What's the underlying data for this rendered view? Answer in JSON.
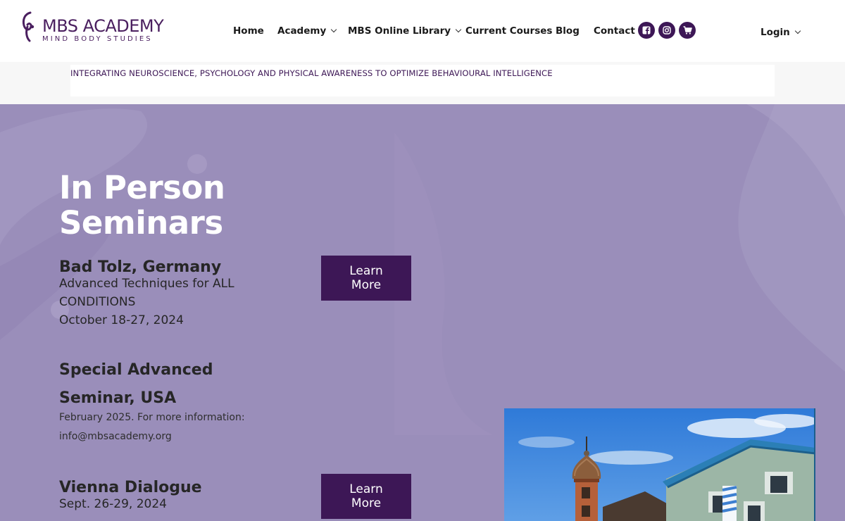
{
  "brand": {
    "title": "MBS ACADEMY",
    "subtitle": "MIND BODY STUDIES",
    "color": "#4a1f5f"
  },
  "nav": {
    "items": [
      {
        "label": "Home",
        "dropdown": false
      },
      {
        "label": "Academy",
        "dropdown": true
      },
      {
        "label": "MBS Online Library",
        "dropdown": true
      },
      {
        "label": "Current Courses",
        "dropdown": false
      },
      {
        "label": "Blog",
        "dropdown": false
      },
      {
        "label": "Contact",
        "dropdown": false
      }
    ],
    "social": [
      "facebook-icon",
      "instagram-icon",
      "cart-icon"
    ],
    "login": "Login"
  },
  "tagline": "INTEGRATING NEUROSCIENCE, PSYCHOLOGY AND PHYSICAL AWARENESS TO OPTIMIZE BEHAVIOURAL INTELLIGENCE",
  "hero": {
    "title_line1": "In Person",
    "title_line2": "Seminars",
    "background": "#9a8eba",
    "accent": "#3d1756"
  },
  "seminars": [
    {
      "title": "Bad Tolz, Germany",
      "line1": "Advanced Techniques for ALL",
      "line2": "CONDITIONS",
      "line3": "October 18-27, 2024",
      "button": "Learn More"
    },
    {
      "title_line1": "Special Advanced",
      "title_line2": "Seminar, USA",
      "info": "February 2025.  For more information:",
      "email": "info@mbsacademy.org"
    },
    {
      "title": "Vienna Dialogue",
      "date": "Sept. 26-29, 2024",
      "button": "Learn More"
    }
  ]
}
